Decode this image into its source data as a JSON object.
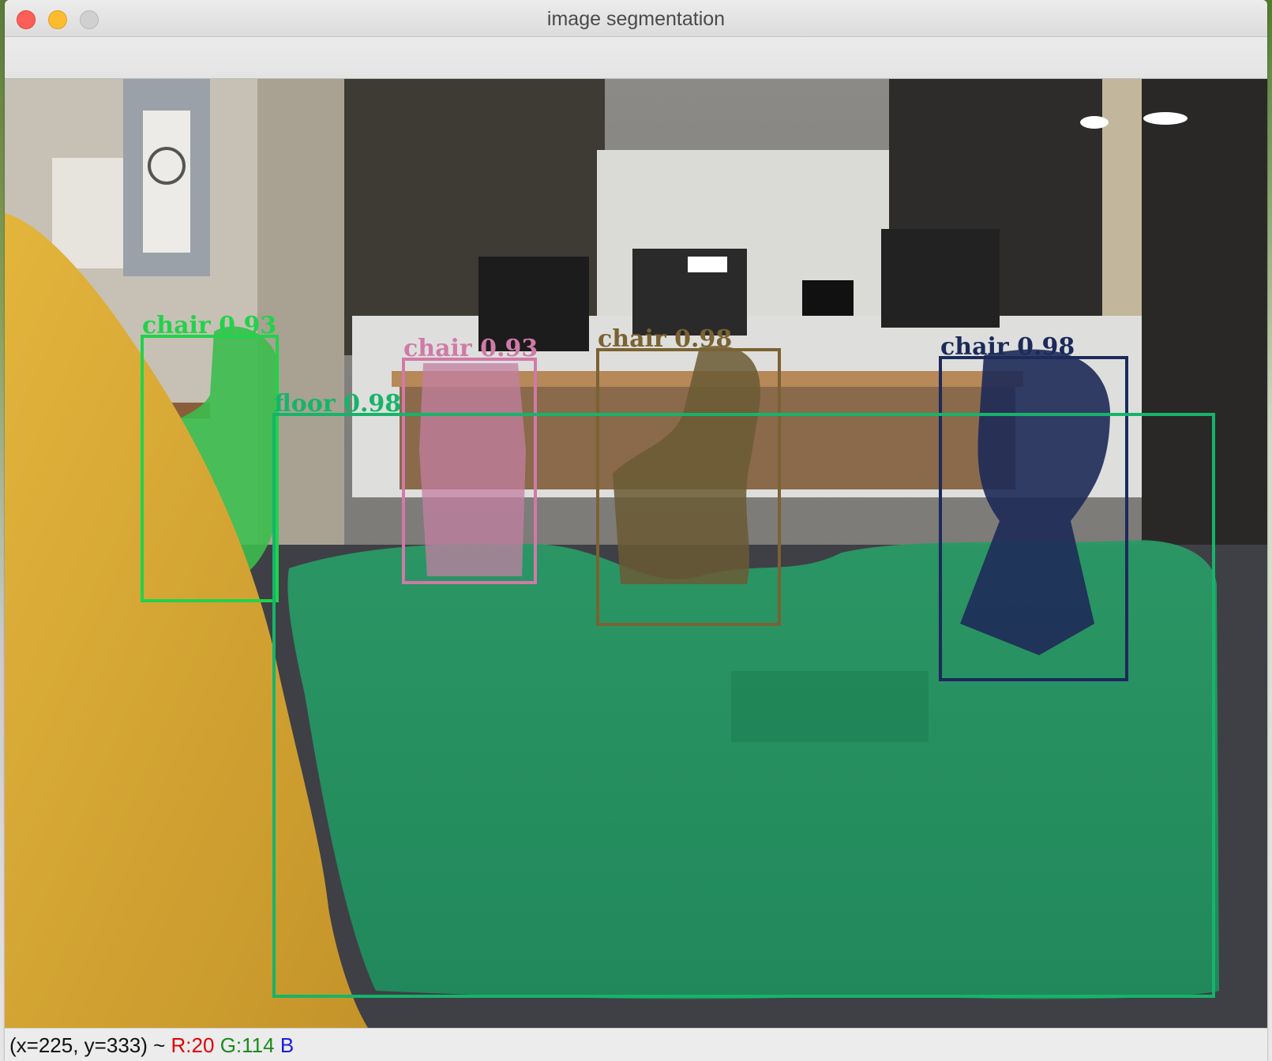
{
  "window": {
    "title": "image segmentation"
  },
  "detections": [
    {
      "label": "chair 0.93",
      "color": "#22d24a"
    },
    {
      "label": "chair 0.93",
      "color": "#d07aa8"
    },
    {
      "label": "chair 0.98",
      "color": "#7a6232"
    },
    {
      "label": "chair 0.98",
      "color": "#1c2a5a"
    },
    {
      "label": "floor 0.98",
      "color": "#16b46a"
    }
  ],
  "status": {
    "coords": "(x=225, y=333) ~ ",
    "r": "R:20",
    "g": "G:114",
    "b": "B"
  }
}
